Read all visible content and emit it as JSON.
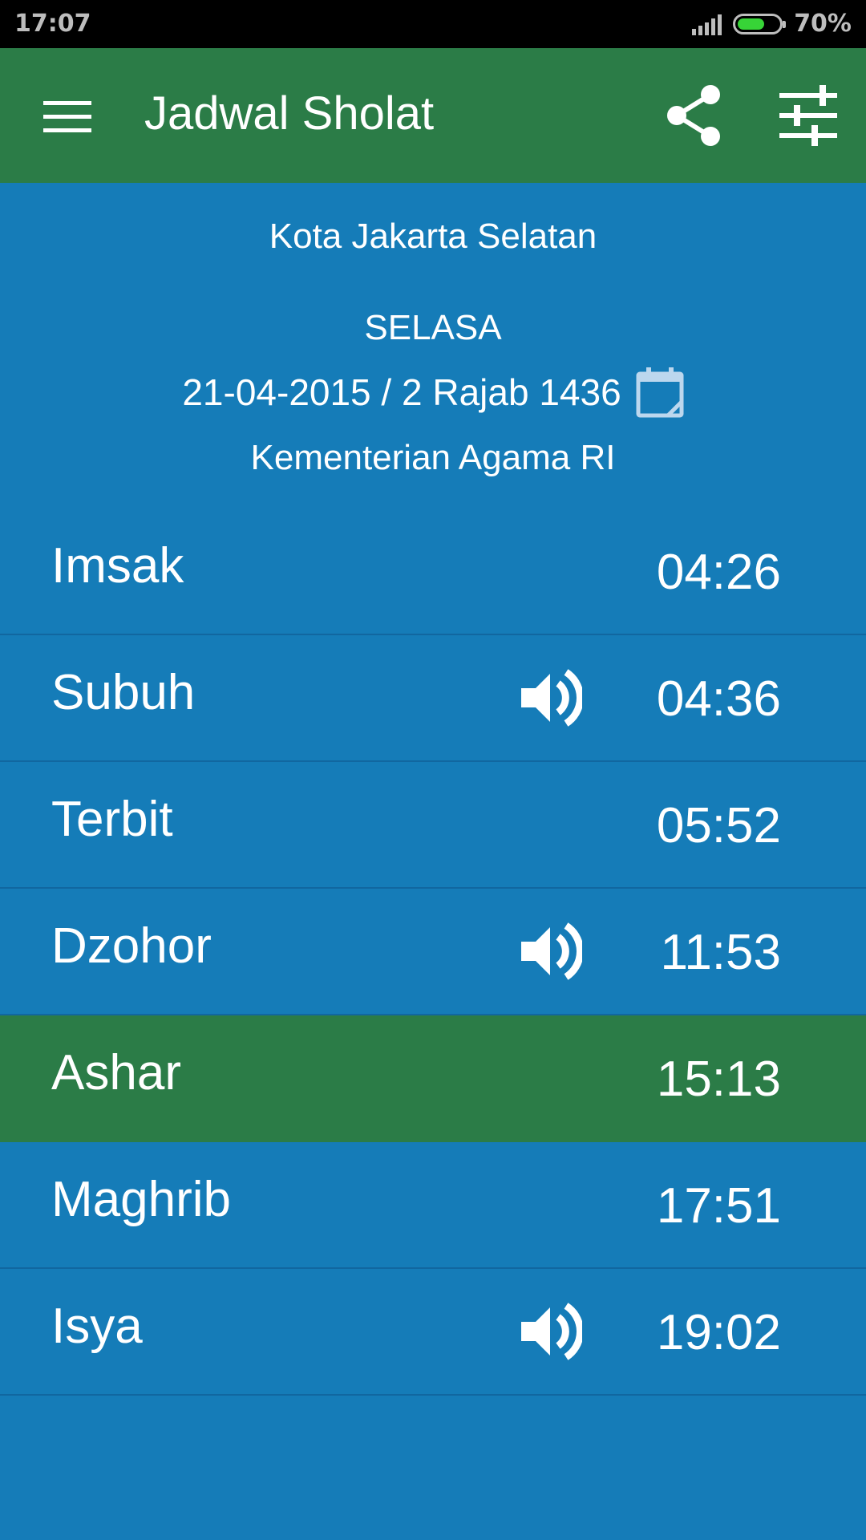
{
  "status_bar": {
    "time": "17:07",
    "battery_text": "70%",
    "battery_level": 0.7,
    "battery_color": "#37d437"
  },
  "app_bar": {
    "title": "Jadwal Sholat",
    "menu_icon": "hamburger-menu-icon",
    "share_icon": "share-icon",
    "settings_icon": "tune-sliders-icon",
    "color": "#2b7c47"
  },
  "header": {
    "location": "Kota Jakarta Selatan",
    "day": "SELASA",
    "date": "21-04-2015 / 2 Rajab 1436",
    "calendar_icon": "calendar-icon",
    "source": "Kementerian Agama RI"
  },
  "prayers": [
    {
      "name": "Imsak",
      "time": "04:26",
      "sound": false,
      "active": false
    },
    {
      "name": "Subuh",
      "time": "04:36",
      "sound": true,
      "active": false
    },
    {
      "name": "Terbit",
      "time": "05:52",
      "sound": false,
      "active": false
    },
    {
      "name": "Dzohor",
      "time": "11:53",
      "sound": true,
      "active": false
    },
    {
      "name": "Ashar",
      "time": "15:13",
      "sound": false,
      "active": true
    },
    {
      "name": "Maghrib",
      "time": "17:51",
      "sound": false,
      "active": false
    },
    {
      "name": "Isya",
      "time": "19:02",
      "sound": true,
      "active": false
    }
  ],
  "colors": {
    "background": "#157cb8",
    "active_row": "#2b7c47"
  }
}
